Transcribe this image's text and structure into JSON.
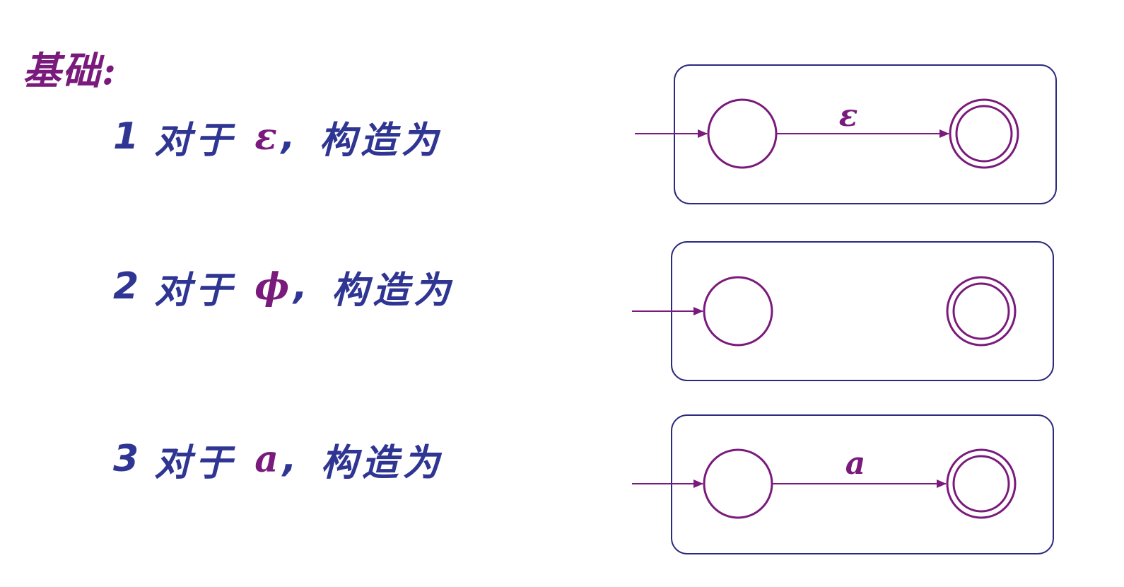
{
  "heading": "基础:",
  "rules": [
    {
      "number": "1",
      "prefix": "对于",
      "symbol": "ε",
      "comma": ",",
      "suffix": "构造为"
    },
    {
      "number": "2",
      "prefix": "对于",
      "symbol": "ϕ",
      "comma": ",",
      "suffix": "构造为"
    },
    {
      "number": "3",
      "prefix": "对于",
      "symbol": "a",
      "comma": ",",
      "suffix": "构造为"
    }
  ],
  "automata": [
    {
      "transition_label": "ε",
      "has_transition": true
    },
    {
      "transition_label": "",
      "has_transition": false
    },
    {
      "transition_label": "a",
      "has_transition": true
    }
  ],
  "colors": {
    "rule_text": "#2f3592",
    "accent": "#7a1a7c",
    "frame": "#2a2a7e"
  }
}
